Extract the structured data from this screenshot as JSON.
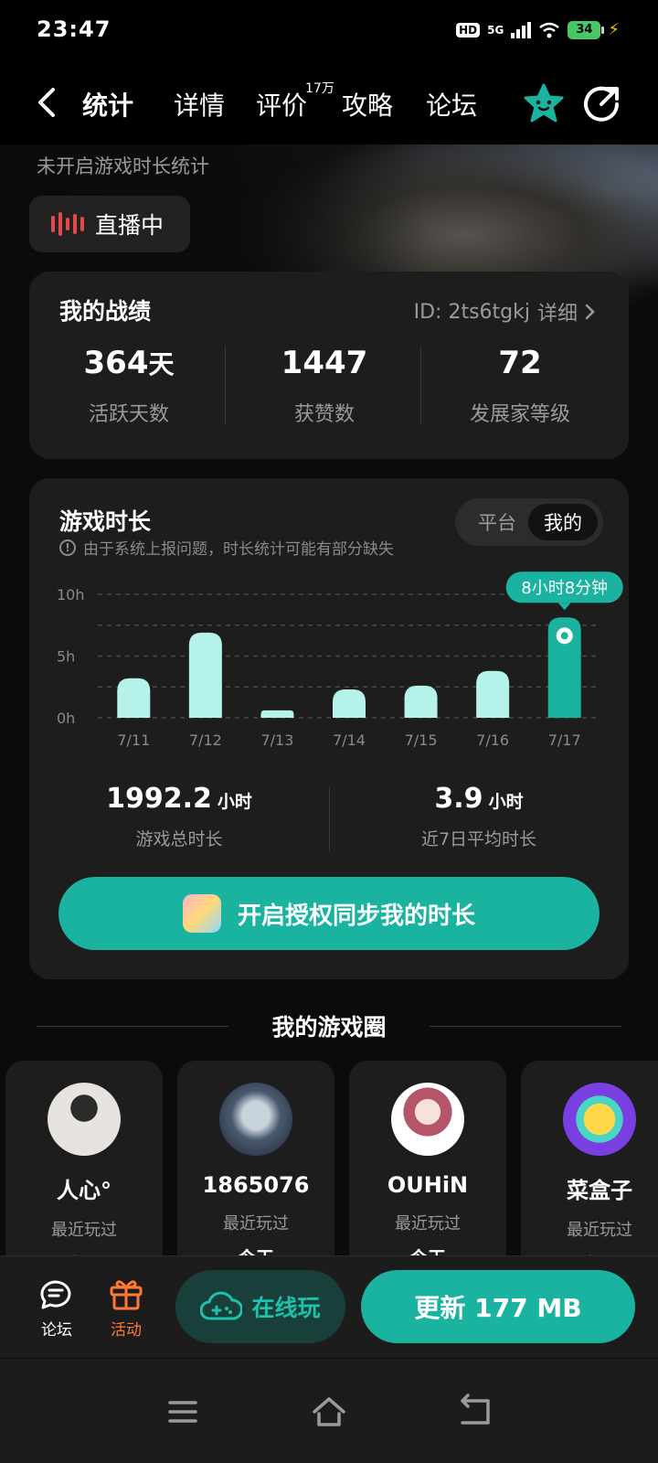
{
  "status_bar": {
    "time": "23:47",
    "hd": "HD",
    "network": "5G",
    "battery": "34"
  },
  "nav": {
    "tabs": [
      "统计",
      "详情",
      "评价",
      "攻略",
      "论坛"
    ],
    "active_tab": "统计",
    "review_count_badge": "17万",
    "accent": "#19b3a0"
  },
  "header": {
    "notice": "未开启游戏时长统计",
    "live_label": "直播中"
  },
  "stats_card": {
    "title": "我的战绩",
    "id_text": "ID: 2ts6tgkj",
    "detail_link": "详细",
    "items": [
      {
        "value": "364",
        "unit": "天",
        "label": "活跃天数"
      },
      {
        "value": "1447",
        "unit": "",
        "label": "获赞数"
      },
      {
        "value": "72",
        "unit": "",
        "label": "发展家等级"
      }
    ]
  },
  "play_card": {
    "title": "游戏时长",
    "toggle": {
      "platform": "平台",
      "mine": "我的",
      "selected": "我的"
    },
    "warning": "由于系统上报问题，时长统计可能有部分缺失",
    "total": {
      "value": "1992.2",
      "unit": "小时",
      "label": "游戏总时长"
    },
    "average": {
      "value": "3.9",
      "unit": "小时",
      "label": "近7日平均时长"
    },
    "auth_button": "开启授权同步我的时长"
  },
  "chart_data": {
    "type": "bar",
    "categories": [
      "7/11",
      "7/12",
      "7/13",
      "7/14",
      "7/15",
      "7/16",
      "7/17"
    ],
    "values": [
      3.2,
      6.9,
      0.6,
      2.3,
      2.6,
      3.8,
      8.13
    ],
    "ylim": [
      0,
      10
    ],
    "yticks": [
      "0h",
      "5h",
      "10h"
    ],
    "highlight_index": 6,
    "highlight_label": "8小时8分钟",
    "bar_color": "#b5f2ea",
    "highlight_color": "#19b3a0",
    "grid": "dashed"
  },
  "game_circle": {
    "title": "我的游戏圈",
    "friends": [
      {
        "name": "人心°",
        "status": "最近玩过",
        "when": "今天"
      },
      {
        "name": "1865076",
        "status": "最近玩过",
        "when": "今天"
      },
      {
        "name": "OUHiN",
        "status": "最近玩过",
        "when": "今天"
      },
      {
        "name": "菜盒子",
        "status": "最近玩过",
        "when": "今天"
      }
    ]
  },
  "bottom_bar": {
    "forum": "论坛",
    "activity": "活动",
    "online_play": "在线玩",
    "update": "更新 177 MB",
    "activity_color": "#ff7a33"
  }
}
